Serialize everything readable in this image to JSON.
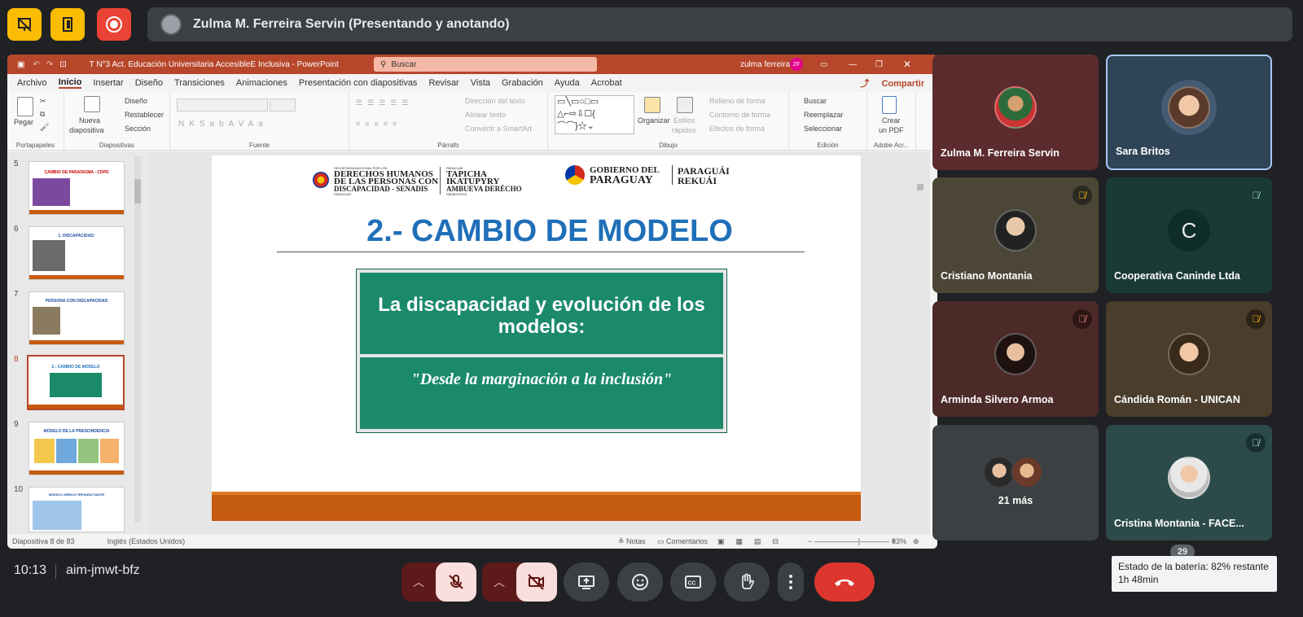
{
  "topbar": {
    "presenter": "Zulma M. Ferreira Servin (Presentando y anotando)"
  },
  "ppt": {
    "title": "T N°3 Act. Educación Universitaria AccesibleE Inclusiva  -  PowerPoint",
    "search_placeholder": "Buscar",
    "user": "zulma ferreira",
    "user_initials": "ZF",
    "tabs": [
      "Archivo",
      "Inicio",
      "Insertar",
      "Diseño",
      "Transiciones",
      "Animaciones",
      "Presentación con diapositivas",
      "Revisar",
      "Vista",
      "Grabación",
      "Ayuda",
      "Acrobat"
    ],
    "share": "Compartir",
    "ribbon": {
      "pegar": "Pegar",
      "portapapeles": "Portapapeles",
      "nueva": "Nueva",
      "diapositiva": "diapositiva",
      "diseno": "Diseño",
      "restablecer": "Restablecer",
      "seccion": "Sección",
      "diapositivas": "Diapositivas",
      "fuente": "Fuente",
      "parrafo": "Párrafo",
      "direccion": "Dirección del texto",
      "alinear": "Alinear texto",
      "convertir": "Convertir a SmartArt",
      "dibujo": "Dibujo",
      "organizar": "Organizar",
      "estilos": "Estilos",
      "rapidos": "rápidos",
      "relleno": "Relleno de forma",
      "contorno": "Contorno de forma",
      "efectos": "Efectos de forma",
      "buscar": "Buscar",
      "reemplazar": "Reemplazar",
      "seleccionar": "Seleccionar",
      "edicion": "Edición",
      "crear": "Crear",
      "pdf": "un PDF",
      "adobe": "Adobe Acr..."
    },
    "slides": [
      {
        "num": "5",
        "title": "CAMBIO DE PARADIGMA - CDPD"
      },
      {
        "num": "6",
        "title": "1. DISCAPACIDAD:"
      },
      {
        "num": "7",
        "title": "PERSONA CON DISCAPACIDAD"
      },
      {
        "num": "8",
        "title": "2.- CAMBIO DE MODELO"
      },
      {
        "num": "9",
        "title": "MODELO DE LA PRESCINDENCIA"
      },
      {
        "num": "10",
        "title": "MODELO MÉDICO REHABILITADOR"
      }
    ],
    "slide": {
      "logo1_small": "SECRETARÍA NACIONAL POR LOS",
      "logo1_line1": "DERECHOS HUMANOS",
      "logo1_line2": "DE LAS PERSONAS CON",
      "logo1_line3": "DISCAPACIDAD - SENADIS",
      "logo1_country": "PARAGUAY",
      "logo2_small": "PARAGUÁI",
      "logo2_line1": "TAPICHA",
      "logo2_line2": "IKATUPYRY",
      "logo2_line3": "AMBUEVA DERÉCHO",
      "logo2_small2": "SÃMBYHYHA",
      "gov_line1": "GOBIERNO DEL",
      "gov_line2": "PARAGUAY",
      "gov_line3": "PARAGUÁI",
      "gov_line4": "REKUÁI",
      "heading": "2.- CAMBIO DE MODELO",
      "sign_top": "La discapacidad y evolución de los modelos:",
      "sign_bottom": "\"Desde la marginación a la inclusión\""
    },
    "status": {
      "slide_info": "Diapositiva 8 de 83",
      "language": "Inglés (Estados Unidos)",
      "notes": "Notas",
      "comments": "Comentarios",
      "zoom": "83%"
    }
  },
  "participants": [
    {
      "name": "Zulma M. Ferreira Servin",
      "muted": false,
      "bg": "#5b2b2e"
    },
    {
      "name": "Sara Britos",
      "muted": false,
      "bg": "#2f4456"
    },
    {
      "name": "Cristiano Montania",
      "muted": true,
      "bg": "#4b4636"
    },
    {
      "name": "Cooperativa Caninde Ltda",
      "muted": true,
      "bg": "#1a3a36",
      "initial": "C"
    },
    {
      "name": "Arminda Silvero Armoa",
      "muted": true,
      "bg": "#4b2a28"
    },
    {
      "name": "Cándida Román - UNICAN",
      "muted": true,
      "bg": "#4a3d2b"
    },
    {
      "name": "21 más",
      "muted": false,
      "bg": "#3c4043"
    },
    {
      "name": "Cristina Montania - FACE...",
      "muted": true,
      "bg": "#2c4a4a"
    }
  ],
  "bottom": {
    "time": "10:13",
    "meeting_code": "aim-jmwt-bfz",
    "participant_count": "29",
    "battery_tooltip": "Estado de la batería: 82% restante 1h 48min"
  },
  "colors": {
    "accent_yellow": "#fbbc04",
    "record_red": "#ea4335",
    "ppt_red": "#b7472a",
    "sign_green": "#1b8a6b",
    "heading_blue": "#1f6fb8"
  }
}
